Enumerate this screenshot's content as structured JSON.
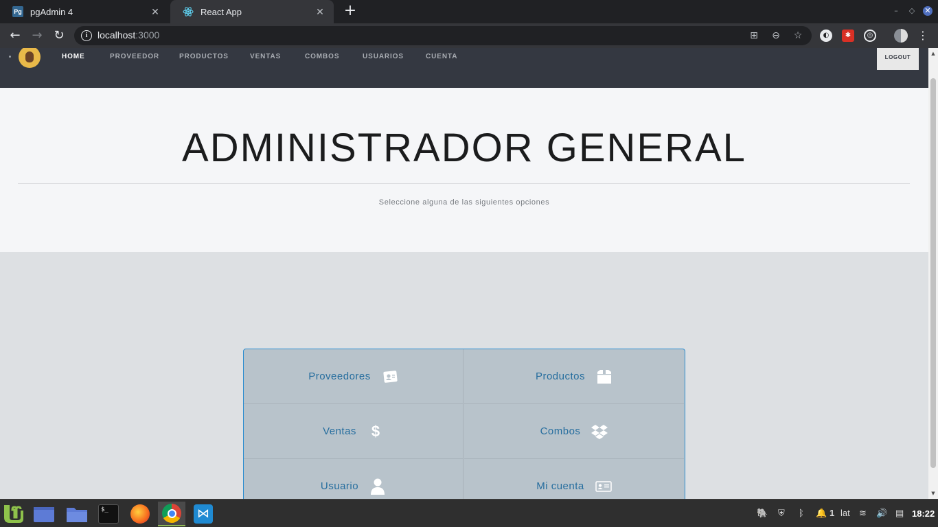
{
  "browser": {
    "tabs": [
      {
        "title": "pgAdmin 4",
        "favicon": "pgadmin-icon",
        "favicon_text": "Pg",
        "active": false
      },
      {
        "title": "React App",
        "favicon": "react-icon",
        "active": true
      }
    ],
    "address": {
      "host": "localhost",
      "port": ":3000"
    }
  },
  "nav": {
    "links": [
      "HOME",
      "PROVEEDOR",
      "PRODUCTOS",
      "VENTAS",
      "COMBOS",
      "USUARIOS",
      "CUENTA"
    ],
    "active_link": "HOME",
    "logout_label": "LOGOUT"
  },
  "hero": {
    "title": "ADMINISTRADOR GENERAL",
    "subtitle": "Seleccione alguna de las siguientes opciones"
  },
  "options": [
    {
      "label": "Proveedores",
      "icon": "address-book-icon"
    },
    {
      "label": "Productos",
      "icon": "box-icon"
    },
    {
      "label": "Ventas",
      "icon": "dollar-icon"
    },
    {
      "label": "Combos",
      "icon": "dropbox-icon"
    },
    {
      "label": "Usuario",
      "icon": "user-icon"
    },
    {
      "label": "Mi cuenta",
      "icon": "id-card-icon"
    }
  ],
  "taskbar": {
    "keyboard_layout": "lat",
    "notification_count": "1",
    "clock": "18:22"
  },
  "colors": {
    "nav_bg": "#343841",
    "hero_bg": "#f5f6f8",
    "grid_border": "#2a8ccf",
    "option_text": "#256d9e"
  }
}
